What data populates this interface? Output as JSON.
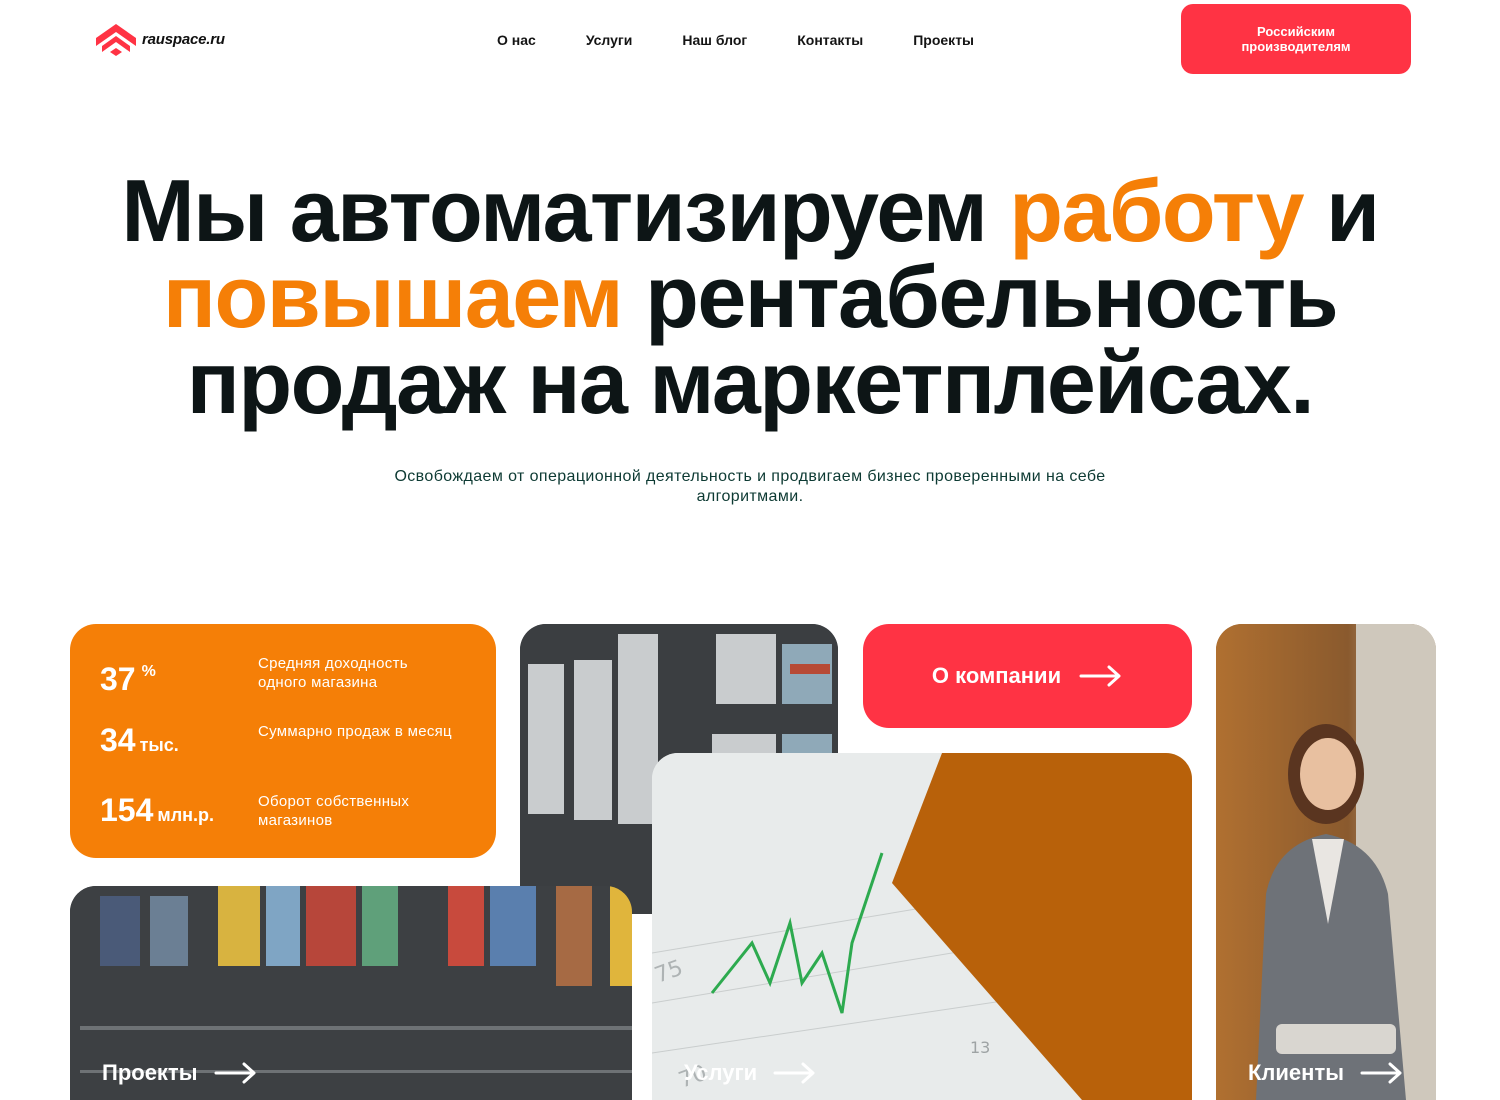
{
  "header": {
    "logo_text": "rauspace.ru",
    "nav": [
      "О нас",
      "Услуги",
      "Наш блог",
      "Контакты",
      "Проекты"
    ],
    "cta": "Российским производителям"
  },
  "hero": {
    "title_part1": "Мы автоматизируем ",
    "title_accent1": "работу",
    "title_part2": " и ",
    "title_accent2": "повышаем",
    "title_part3": " рентабельность продаж на маркетплейсах.",
    "subtitle": "Освобождаем от операционной деятельность и продвигаем бизнес проверенными на себе алгоритмами."
  },
  "stats": [
    {
      "value": "37",
      "unit": "%",
      "desc": "Средняя доходность одного магазина"
    },
    {
      "value": "34",
      "unit": "тыс.",
      "desc": "Суммарно продаж в месяц"
    },
    {
      "value": "154",
      "unit": "млн.р.",
      "desc": "Оборот собственных магазинов"
    }
  ],
  "tiles": {
    "about": "О компании",
    "projects": "Проекты",
    "services": "Услуги",
    "clients": "Клиенты"
  },
  "chart_axis_labels": [
    "75",
    "70",
    "13"
  ],
  "colors": {
    "accent_orange": "#f57f07",
    "accent_red": "#ff3344",
    "text_dark": "#0d1516",
    "subtitle": "#0d3a33"
  },
  "icons": [
    "logo-icon",
    "arrow-right-icon"
  ]
}
